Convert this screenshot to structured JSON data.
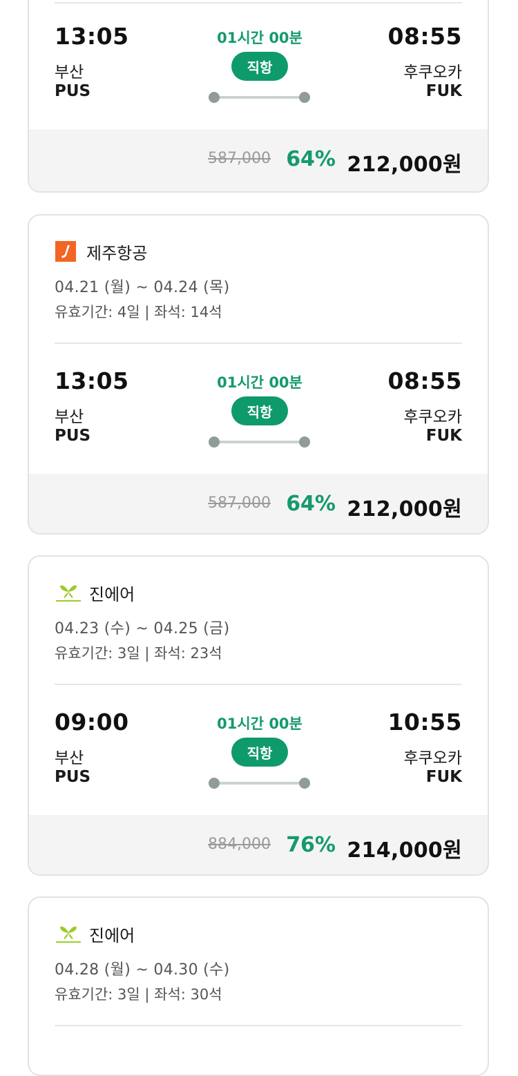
{
  "tickets": [
    {
      "airline": "",
      "dates": "",
      "validity": "",
      "depart_time": "13:05",
      "depart_city": "부산",
      "depart_code": "PUS",
      "duration": "01시간 00분",
      "flight_type": "직항",
      "arrive_time": "08:55",
      "arrive_city": "후쿠오카",
      "arrive_code": "FUK",
      "original_price": "587,000",
      "discount": "64%",
      "price": "212,000원"
    },
    {
      "airline": "제주항공",
      "logo_icon": "jeju-air-logo-icon",
      "dates": "04.21 (월) ~ 04.24 (목)",
      "validity": "유효기간: 4일 | 좌석: 14석",
      "depart_time": "13:05",
      "depart_city": "부산",
      "depart_code": "PUS",
      "duration": "01시간 00분",
      "flight_type": "직항",
      "arrive_time": "08:55",
      "arrive_city": "후쿠오카",
      "arrive_code": "FUK",
      "original_price": "587,000",
      "discount": "64%",
      "price": "212,000원"
    },
    {
      "airline": "진에어",
      "logo_icon": "jin-air-logo-icon",
      "dates": "04.23 (수) ~ 04.25 (금)",
      "validity": "유효기간: 3일 | 좌석: 23석",
      "depart_time": "09:00",
      "depart_city": "부산",
      "depart_code": "PUS",
      "duration": "01시간 00분",
      "flight_type": "직항",
      "arrive_time": "10:55",
      "arrive_city": "후쿠오카",
      "arrive_code": "FUK",
      "original_price": "884,000",
      "discount": "76%",
      "price": "214,000원"
    },
    {
      "airline": "진에어",
      "logo_icon": "jin-air-logo-icon",
      "dates": "04.28 (월) ~ 04.30 (수)",
      "validity": "유효기간: 3일 | 좌석: 30석"
    }
  ],
  "colors": {
    "accent_green": "#159a6b",
    "badge_green": "#0f9a6b",
    "jeju_orange": "#f26522",
    "jin_lime": "#9ccc2a"
  }
}
